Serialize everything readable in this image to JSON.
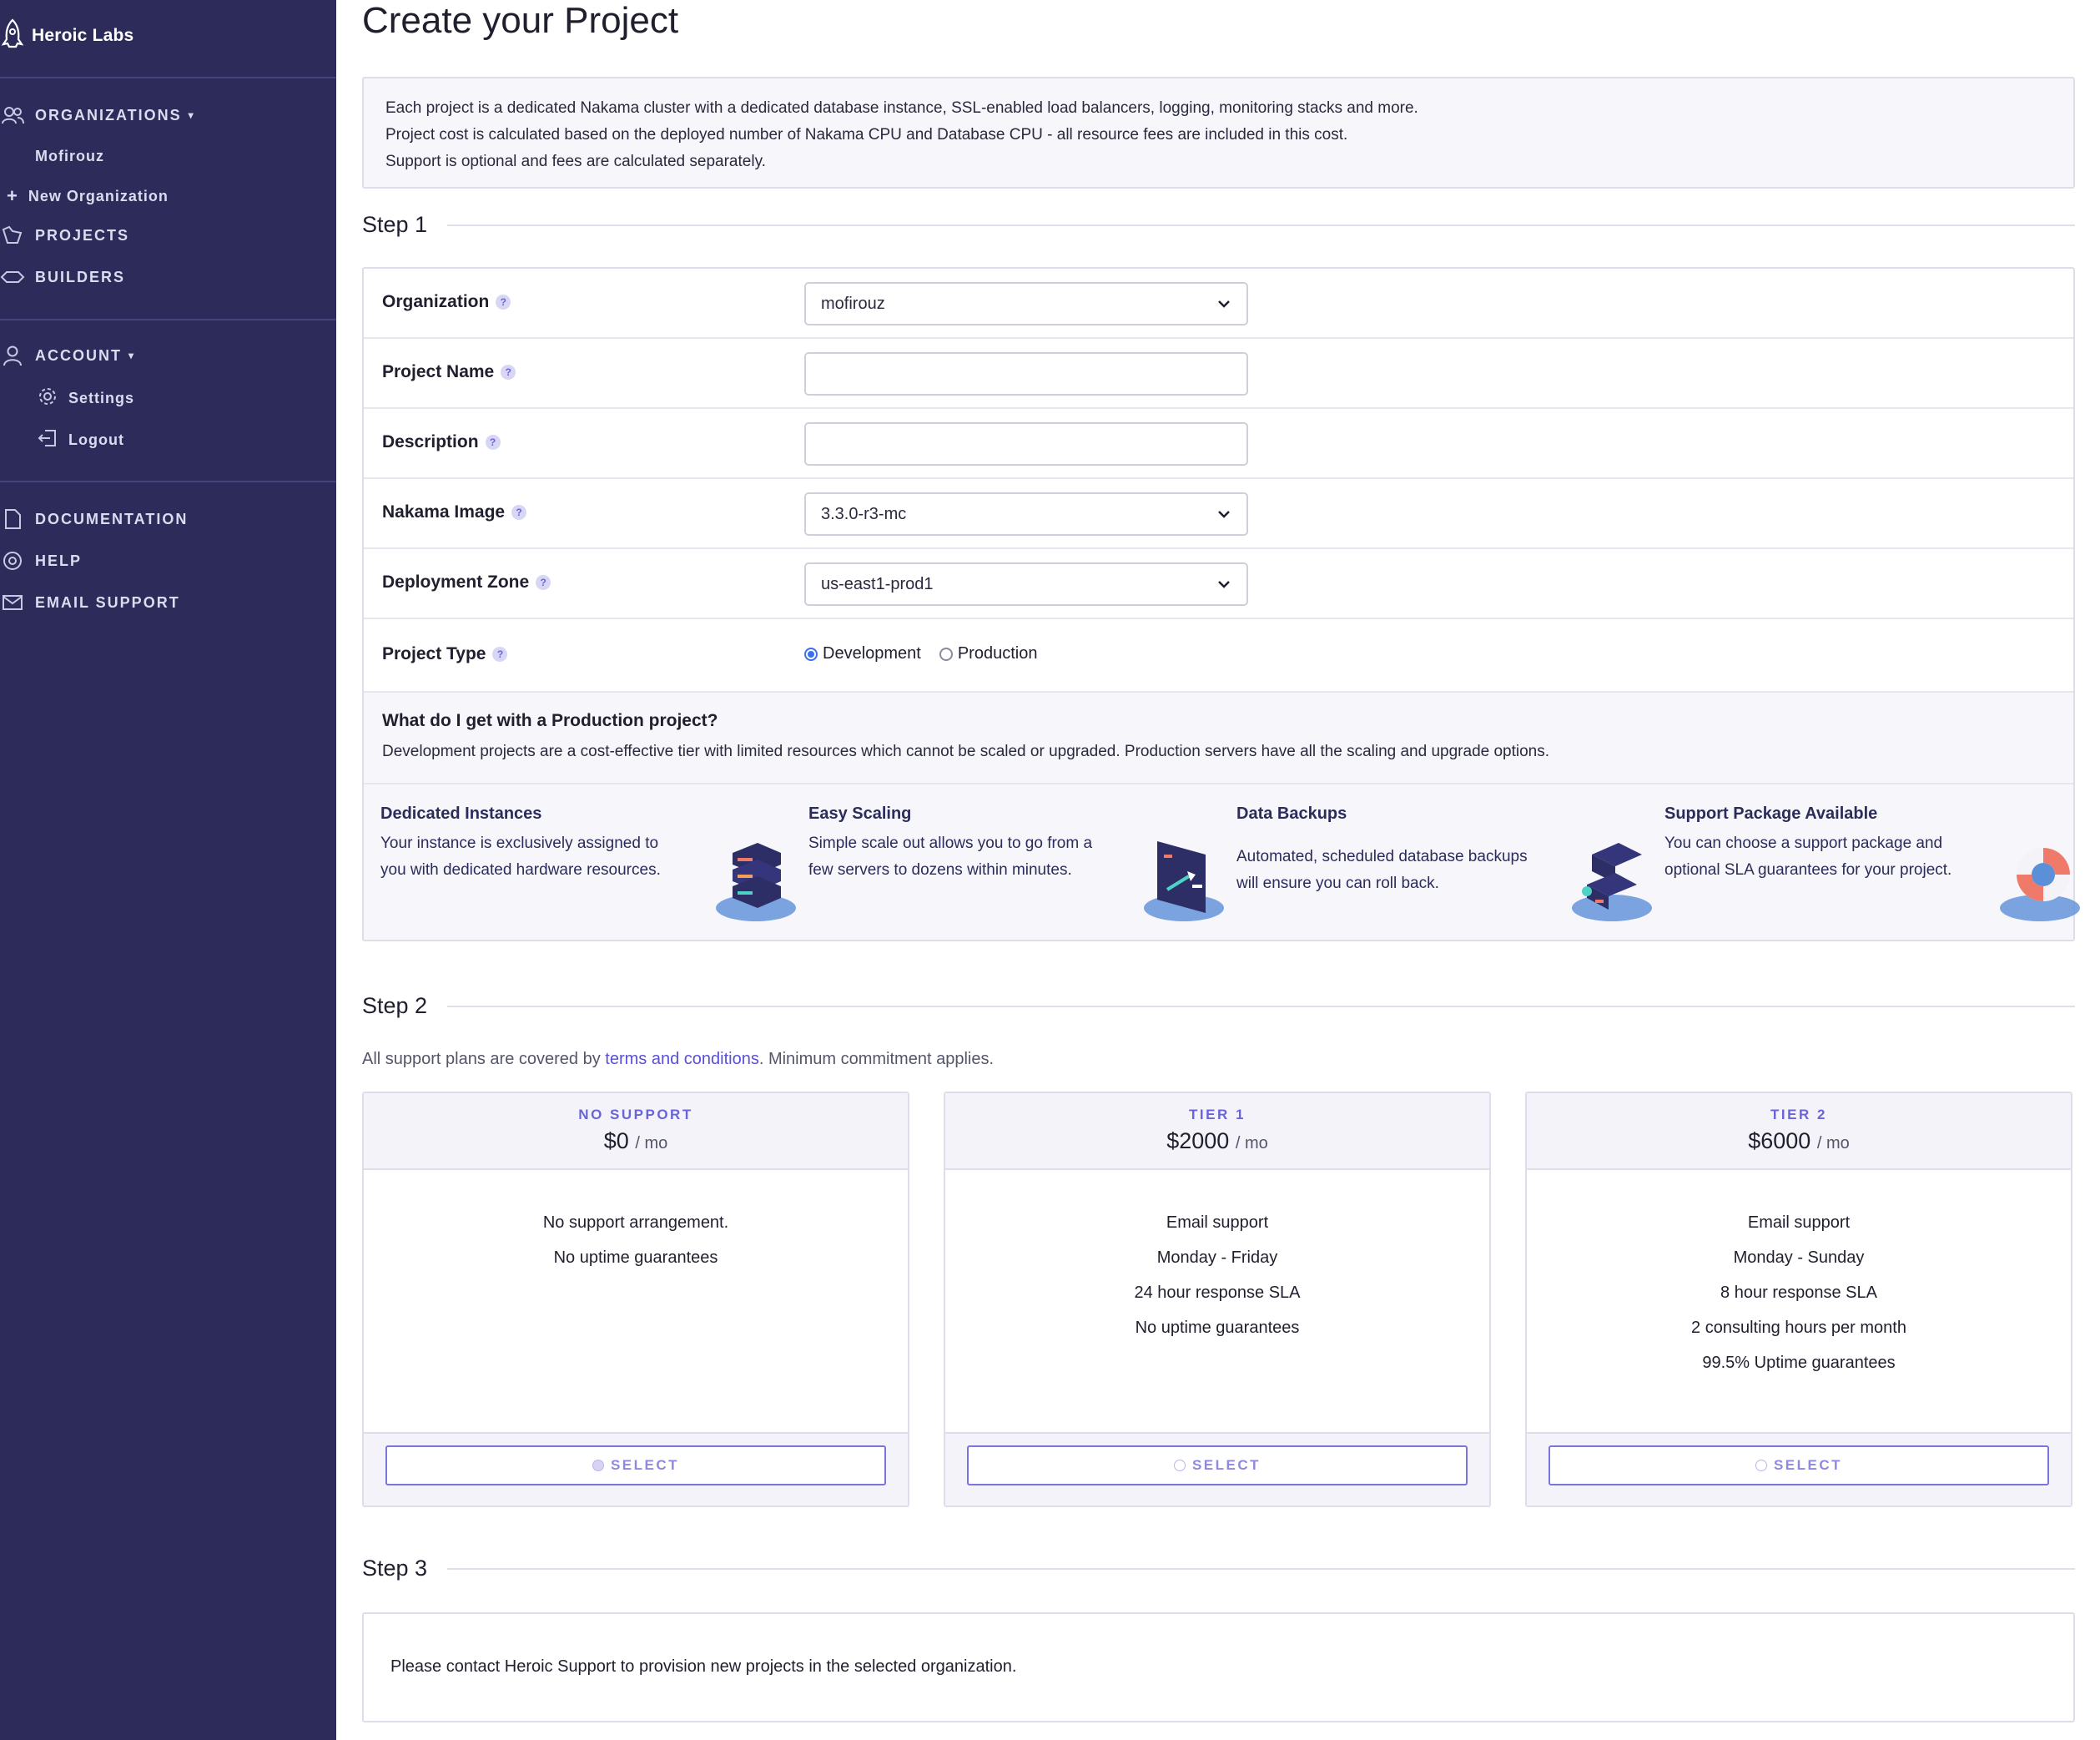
{
  "brand": {
    "name": "Heroic Labs"
  },
  "sidebar": {
    "organizations": {
      "label": "ORGANIZATIONS",
      "items": [
        "Mofirouz"
      ],
      "new_label": "New Organization"
    },
    "projects_label": "PROJECTS",
    "builders_label": "BUILDERS",
    "account": {
      "label": "ACCOUNT",
      "settings_label": "Settings",
      "logout_label": "Logout"
    },
    "documentation_label": "DOCUMENTATION",
    "help_label": "HELP",
    "email_support_label": "EMAIL SUPPORT"
  },
  "page": {
    "title": "Create your Project",
    "info_lines": [
      "Each project is a dedicated Nakama cluster with a dedicated database instance, SSL-enabled load balancers, logging, monitoring stacks and more.",
      "Project cost is calculated based on the deployed number of Nakama CPU and Database CPU - all resource fees are included in this cost.",
      "Support is optional and fees are calculated separately."
    ]
  },
  "step1": {
    "label": "Step 1",
    "fields": {
      "organization": {
        "label": "Organization",
        "value": "mofirouz"
      },
      "project_name": {
        "label": "Project Name",
        "value": ""
      },
      "description": {
        "label": "Description",
        "value": ""
      },
      "nakama_image": {
        "label": "Nakama Image",
        "value": "3.3.0-r3-mc"
      },
      "deployment_zone": {
        "label": "Deployment Zone",
        "value": "us-east1-prod1"
      },
      "project_type": {
        "label": "Project Type",
        "options": [
          "Development",
          "Production"
        ],
        "selected": "Development"
      }
    },
    "production_info": {
      "question": "What do I get with a Production project?",
      "description": "Development projects are a cost-effective tier with limited resources which cannot be scaled or upgraded. Production servers have all the scaling and upgrade options.",
      "features": [
        {
          "title": "Dedicated Instances",
          "text": "Your instance is exclusively assigned to you with dedicated hardware resources."
        },
        {
          "title": "Easy Scaling",
          "text": "Simple scale out allows you to go from a few servers to dozens within minutes."
        },
        {
          "title": "Data Backups",
          "text": "Automated, scheduled database backups will ensure you can roll back."
        },
        {
          "title": "Support Package Available",
          "text": "You can choose a support package and optional SLA guarantees for your project."
        }
      ]
    }
  },
  "step2": {
    "label": "Step 2",
    "intro_before": "All support plans are covered by ",
    "intro_link": "terms and conditions",
    "intro_after": ". Minimum commitment applies.",
    "plans": [
      {
        "tier": "NO SUPPORT",
        "price": "$0",
        "per": "/ mo",
        "features": [
          "No support arrangement.",
          "No uptime guarantees"
        ],
        "button": "SELECT",
        "selected": true
      },
      {
        "tier": "TIER 1",
        "price": "$2000",
        "per": "/ mo",
        "features": [
          "Email support",
          "Monday - Friday",
          "24 hour response SLA",
          "No uptime guarantees"
        ],
        "button": "SELECT",
        "selected": false
      },
      {
        "tier": "TIER 2",
        "price": "$6000",
        "per": "/ mo",
        "features": [
          "Email support",
          "Monday - Sunday",
          "8 hour response SLA",
          "2 consulting hours per month",
          "99.5% Uptime guarantees"
        ],
        "button": "SELECT",
        "selected": false
      }
    ]
  },
  "step3": {
    "label": "Step 3",
    "message": "Please contact Heroic Support to provision new projects in the selected organization."
  },
  "colors": {
    "sidebar_bg": "#2c2b5a",
    "accent": "#6b64d8",
    "radio_selected": "#3a6ff0",
    "link": "#5a4fd6"
  },
  "icons": [
    "rocket-icon",
    "users-icon",
    "plus-icon",
    "projects-icon",
    "builders-icon",
    "user-icon",
    "gear-icon",
    "logout-icon",
    "document-icon",
    "help-icon",
    "mail-icon",
    "help-dot-icon",
    "chevron-down-icon"
  ]
}
